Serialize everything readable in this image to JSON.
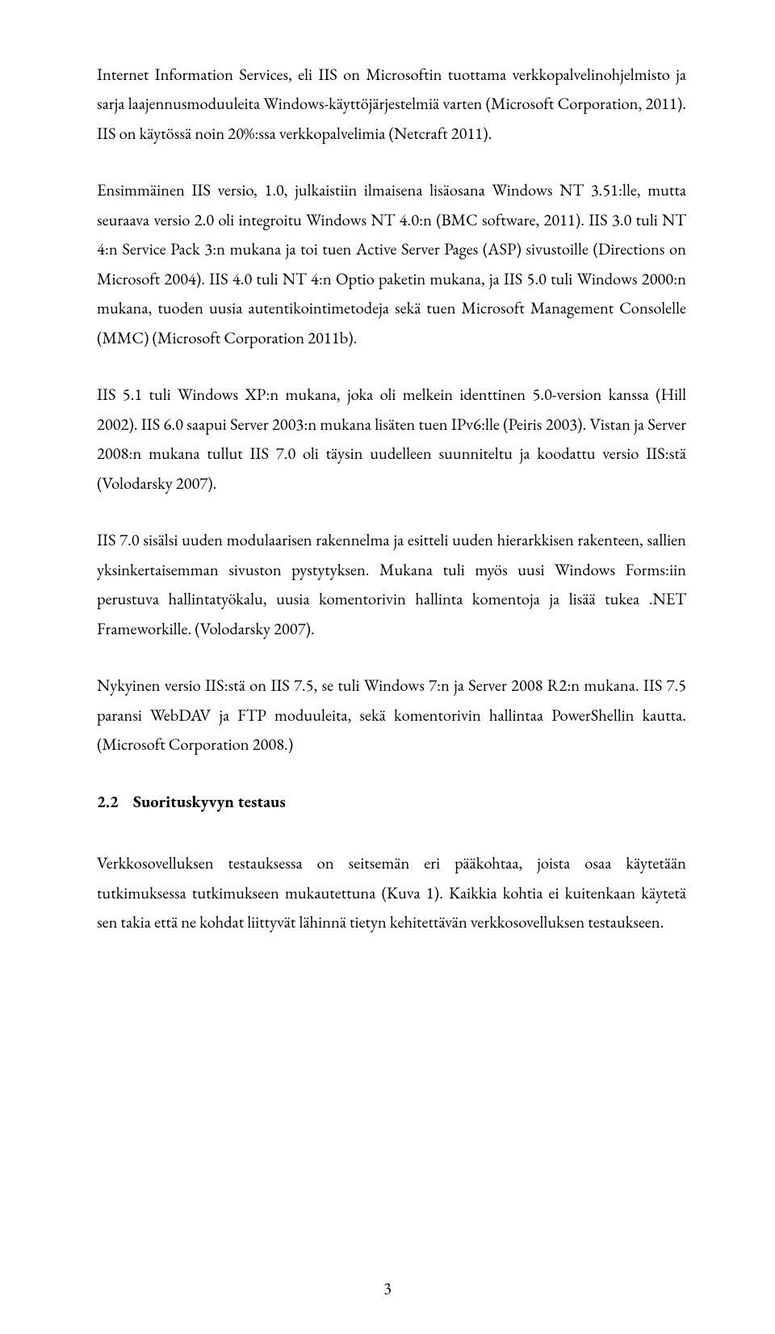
{
  "paragraphs": {
    "p1": "Internet Information Services, eli IIS on Microsoftin tuottama verkkopalvelinohjelmisto ja sarja laajennusmoduuleita Windows-käyttöjärjestelmiä varten (Microsoft Corporation, 2011). IIS on käytössä noin 20%:ssa verkkopalvelimia (Netcraft 2011).",
    "p2": "Ensimmäinen IIS versio, 1.0, julkaistiin ilmaisena lisäosana Windows NT 3.51:lle, mutta seuraava versio 2.0 oli integroitu Windows NT 4.0:n (BMC software, 2011). IIS 3.0 tuli NT 4:n Service Pack 3:n mukana ja toi tuen Active Server Pages (ASP) sivustoille (Directions on Microsoft 2004). IIS 4.0 tuli NT 4:n Optio paketin mukana, ja IIS 5.0 tuli Windows 2000:n mukana, tuoden uusia autentikointimetodeja sekä tuen Microsoft Management Consolelle (MMC) (Microsoft Corporation 2011b).",
    "p3": "IIS 5.1 tuli Windows XP:n mukana, joka oli melkein identtinen 5.0-version kanssa (Hill 2002). IIS 6.0 saapui Server 2003:n mukana lisäten tuen IPv6:lle (Peiris 2003). Vistan ja Server 2008:n mukana tullut IIS 7.0 oli täysin uudelleen suunniteltu ja koodattu versio IIS:stä (Volodarsky 2007).",
    "p4": "IIS 7.0 sisälsi uuden modulaarisen rakennelma ja esitteli uuden hierarkkisen rakenteen, sallien yksinkertaisemman sivuston pystytyksen. Mukana tuli myös uusi Windows Forms:iin perustuva hallintatyökalu, uusia komentorivin hallinta komentoja ja lisää tukea .NET Frameworkille. (Volodarsky 2007).",
    "p5": "Nykyinen versio IIS:stä on IIS 7.5, se tuli Windows 7:n ja Server 2008 R2:n mukana. IIS 7.5 paransi WebDAV ja FTP moduuleita, sekä komentorivin hallintaa PowerShellin kautta. (Microsoft Corporation 2008.)"
  },
  "section": {
    "number": "2.2",
    "title": "Suorituskyvyn testaus"
  },
  "paragraphs2": {
    "p6": "Verkkosovelluksen testauksessa on seitsemän eri pääkohtaa, joista osaa käytetään tutkimuksessa tutkimukseen mukautettuna (Kuva 1). Kaikkia kohtia ei kuitenkaan käytetä sen takia että ne kohdat liittyvät lähinnä tietyn kehitettävän verkkosovelluksen testaukseen."
  },
  "pageNumber": "3"
}
